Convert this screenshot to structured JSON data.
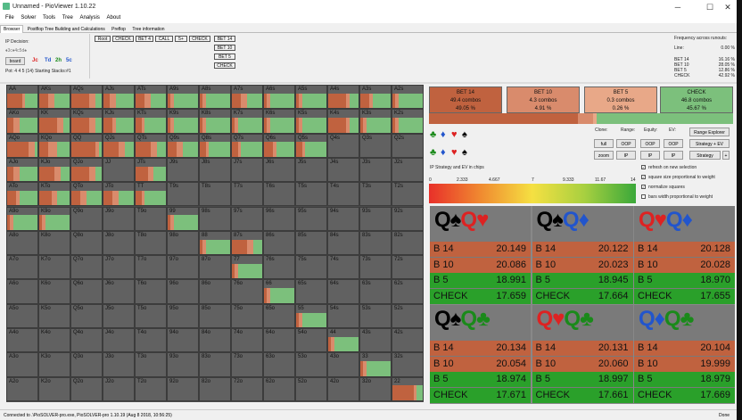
{
  "window": {
    "title": "Unnamed - PioViewer 1.10.22",
    "min": "─",
    "max": "☐",
    "close": "✕"
  },
  "menu": [
    "File",
    "Solver",
    "Tools",
    "Tree",
    "Analysis",
    "About"
  ],
  "tabs": [
    "Browser",
    "Postflop Tree Building and Calculations",
    "Preflop",
    "Tree information"
  ],
  "left": {
    "ip_decision": "IP Decision:",
    "board_small": "♦3c♦4c5d♠",
    "board_btn": "board",
    "board_cards": [
      "Jc",
      "Td",
      "2h",
      "5c"
    ],
    "pot": "Pot: 4 4 5 (14) Starting Stacks:#1"
  },
  "nav": [
    {
      "label": "Root",
      "color": "#d98b6c"
    },
    {
      "label": "CHECK",
      "color": "#8cc08c"
    },
    {
      "label": "BET 4",
      "color": "#d98b6c"
    },
    {
      "label": "CALL",
      "color": "#8cc08c"
    },
    {
      "label": "5+",
      "color": "#8cc08c"
    },
    {
      "label": "CHECK",
      "color": "#f0d060"
    }
  ],
  "nav2": [
    {
      "label": "BET 14",
      "color": "#c0623f"
    },
    {
      "label": "BET 10",
      "color": "#d98b6c"
    },
    {
      "label": "BET 5",
      "color": "#e8a888"
    },
    {
      "label": "CHECK",
      "color": "#7cc07c"
    }
  ],
  "freq": {
    "title": "Frequency across runouts:",
    "line_label": "Line:",
    "line_val": "0.00 %",
    "rows": [
      {
        "k": "BET 14",
        "v": "16.16 %"
      },
      {
        "k": "BET 10",
        "v": "28.05 %"
      },
      {
        "k": "BET 5",
        "v": "12.86 %"
      },
      {
        "k": "CHECK",
        "v": "42.92 %"
      }
    ]
  },
  "grid": {
    "ranks": [
      "A",
      "K",
      "Q",
      "J",
      "T",
      "9",
      "8",
      "7",
      "6",
      "5",
      "4",
      "3",
      "2"
    ],
    "custom": {
      "AA": [
        0.5,
        0.1,
        0,
        0.4
      ],
      "AKs": [
        0.3,
        0.2,
        0,
        0.5
      ],
      "AQs": [
        0.6,
        0.2,
        0,
        0.2
      ],
      "AJs": [
        0.2,
        0.2,
        0,
        0.6
      ],
      "ATs": [
        0.3,
        0.2,
        0,
        0.5
      ],
      "A9s": [
        0.1,
        0.1,
        0,
        0.8
      ],
      "A8s": [
        0.1,
        0.1,
        0,
        0.8
      ],
      "A7s": [
        0.3,
        0.2,
        0,
        0.5
      ],
      "A6s": [
        0.1,
        0.1,
        0,
        0.8
      ],
      "A5s": [
        0.1,
        0.1,
        0,
        0.8
      ],
      "A4s": [
        0.6,
        0.1,
        0,
        0.3
      ],
      "A3s": [
        0.3,
        0.1,
        0,
        0.6
      ],
      "A2s": [
        0.1,
        0.1,
        0,
        0.8
      ],
      "AKo": [
        0.2,
        0.2,
        0,
        0.6
      ],
      "KK": [
        0.6,
        0.2,
        0,
        0.2
      ],
      "KQs": [
        0.6,
        0.2,
        0,
        0.2
      ],
      "KJs": [
        0.3,
        0.1,
        0,
        0.6
      ],
      "KTs": [
        0.2,
        0.1,
        0,
        0.7
      ],
      "K9s": [
        0.1,
        0.1,
        0,
        0.8
      ],
      "K8s": [
        0.1,
        0.1,
        0,
        0.8
      ],
      "K7s": [
        0.1,
        0.1,
        0,
        0.8
      ],
      "K6s": [
        0.1,
        0.1,
        0,
        0.8
      ],
      "K5s": [
        0.1,
        0.1,
        0,
        0.8
      ],
      "K4s": [
        0.6,
        0.1,
        0,
        0.3
      ],
      "K3s": [
        0.1,
        0.1,
        0,
        0.8
      ],
      "K2s": [
        0.1,
        0.1,
        0,
        0.8
      ],
      "AQo": [
        0.7,
        0.2,
        0,
        0.1
      ],
      "KQo": [
        0.3,
        0.3,
        0,
        0.4
      ],
      "QQ": [
        0.8,
        0.1,
        0,
        0.1
      ],
      "QJs": [
        0.5,
        0.2,
        0,
        0.3
      ],
      "QTs": [
        0.5,
        0.2,
        0,
        0.3
      ],
      "Q9s": [
        0.3,
        0.2,
        0,
        0.5
      ],
      "Q8s": [
        0.2,
        0.1,
        0,
        0.7
      ],
      "Q7s": [
        0.2,
        0.1,
        0,
        0.7
      ],
      "Q6s": [
        0.3,
        0.1,
        0,
        0.6
      ],
      "Q5s": [
        0.2,
        0.1,
        0,
        0.7
      ],
      "AJo": [
        0.2,
        0.2,
        0,
        0.6
      ],
      "KJo": [
        0.5,
        0.2,
        0,
        0.3
      ],
      "QJo": [
        0.6,
        0.2,
        0,
        0.2
      ],
      "JTs": [
        0.4,
        0.2,
        0,
        0.4
      ],
      "ATo": [
        0.3,
        0.1,
        0,
        0.6
      ],
      "KTo": [
        0.4,
        0.2,
        0,
        0.4
      ],
      "QTo": [
        0.3,
        0.2,
        0,
        0.5
      ],
      "JTo": [
        0.3,
        0.2,
        0,
        0.5
      ],
      "TT": [
        0.2,
        0.1,
        0,
        0.7
      ],
      "A9o": [
        0.1,
        0.1,
        0,
        0.8
      ],
      "K9o": [
        0.1,
        0.1,
        0,
        0.8
      ],
      "99": [
        0.1,
        0.1,
        0,
        0.8
      ],
      "88": [
        0.1,
        0.1,
        0,
        0.8
      ],
      "87s": [
        0.5,
        0.2,
        0,
        0.3
      ],
      "77": [
        0.1,
        0.1,
        0,
        0.8
      ],
      "66": [
        0.1,
        0.1,
        0,
        0.8
      ],
      "55": [
        0.1,
        0.1,
        0,
        0.8
      ],
      "44": [
        0.1,
        0.1,
        0,
        0.8
      ],
      "33": [
        0.1,
        0.1,
        0,
        0.8
      ],
      "22": [
        0.7,
        0.1,
        0,
        0.2
      ]
    }
  },
  "actions": [
    {
      "label": "BET 14",
      "combos": "49.4 combos",
      "pct": "49.05 %",
      "color": "#c0623f"
    },
    {
      "label": "BET 10",
      "combos": "4.3 combos",
      "pct": "4.91 %",
      "color": "#d98b6c"
    },
    {
      "label": "BET 5",
      "combos": "0.3 combos",
      "pct": "0.26 %",
      "color": "#e8a888"
    },
    {
      "label": "CHECK",
      "combos": "46.8 combos",
      "pct": "45.67 %",
      "color": "#7cc07c"
    }
  ],
  "clone": {
    "label_clone": "Clone:",
    "label_range": "Range:",
    "label_equity": "Equity:",
    "label_ev": "EV:",
    "full": "full",
    "zoom": "zoom",
    "oop": "OOP",
    "ip": "IP",
    "range_explorer": "Range Explorer",
    "strategy_ev": "Strategy + EV",
    "strategy": "Strategy",
    "plus": "+"
  },
  "equity": {
    "title": "IP Strategy and EV in chips",
    "ticks": [
      "0",
      "2.333",
      "4.667",
      "7",
      "9.333",
      "11.67",
      "14"
    ]
  },
  "checks": [
    "refresh on new selection",
    "square size proportional to weight",
    "normalize squares",
    "bars width proportional to weight"
  ],
  "combos": [
    {
      "cards": [
        {
          "r": "Q",
          "s": "♠",
          "c": "#000"
        },
        {
          "r": "Q",
          "s": "♥",
          "c": "#d22"
        }
      ],
      "vals": [
        "20.149",
        "20.086",
        "18.991",
        "17.659"
      ]
    },
    {
      "cards": [
        {
          "r": "Q",
          "s": "♠",
          "c": "#000"
        },
        {
          "r": "Q",
          "s": "♦",
          "c": "#2255cc"
        }
      ],
      "vals": [
        "20.122",
        "20.023",
        "18.945",
        "17.664"
      ]
    },
    {
      "cards": [
        {
          "r": "Q",
          "s": "♥",
          "c": "#d22"
        },
        {
          "r": "Q",
          "s": "♦",
          "c": "#2255cc"
        }
      ],
      "vals": [
        "20.128",
        "20.028",
        "18.970",
        "17.655"
      ]
    },
    {
      "cards": [
        {
          "r": "Q",
          "s": "♠",
          "c": "#000"
        },
        {
          "r": "Q",
          "s": "♣",
          "c": "#1a8a1a"
        }
      ],
      "vals": [
        "20.134",
        "20.054",
        "18.974",
        "17.671"
      ]
    },
    {
      "cards": [
        {
          "r": "Q",
          "s": "♥",
          "c": "#d22"
        },
        {
          "r": "Q",
          "s": "♣",
          "c": "#1a8a1a"
        }
      ],
      "vals": [
        "20.131",
        "20.060",
        "18.997",
        "17.661"
      ]
    },
    {
      "cards": [
        {
          "r": "Q",
          "s": "♦",
          "c": "#2255cc"
        },
        {
          "r": "Q",
          "s": "♣",
          "c": "#1a8a1a"
        }
      ],
      "vals": [
        "20.104",
        "19.999",
        "18.979",
        "17.669"
      ]
    }
  ],
  "combo_rows": [
    "B 14",
    "B 10",
    "B 5",
    "CHECK"
  ],
  "status": {
    "left": "Connected to .\\PioSOLVER-pro.exe, PioSOLVER-pro 1.10.19 (Aug  8 2018, 10:56:25)",
    "right": "Done"
  }
}
